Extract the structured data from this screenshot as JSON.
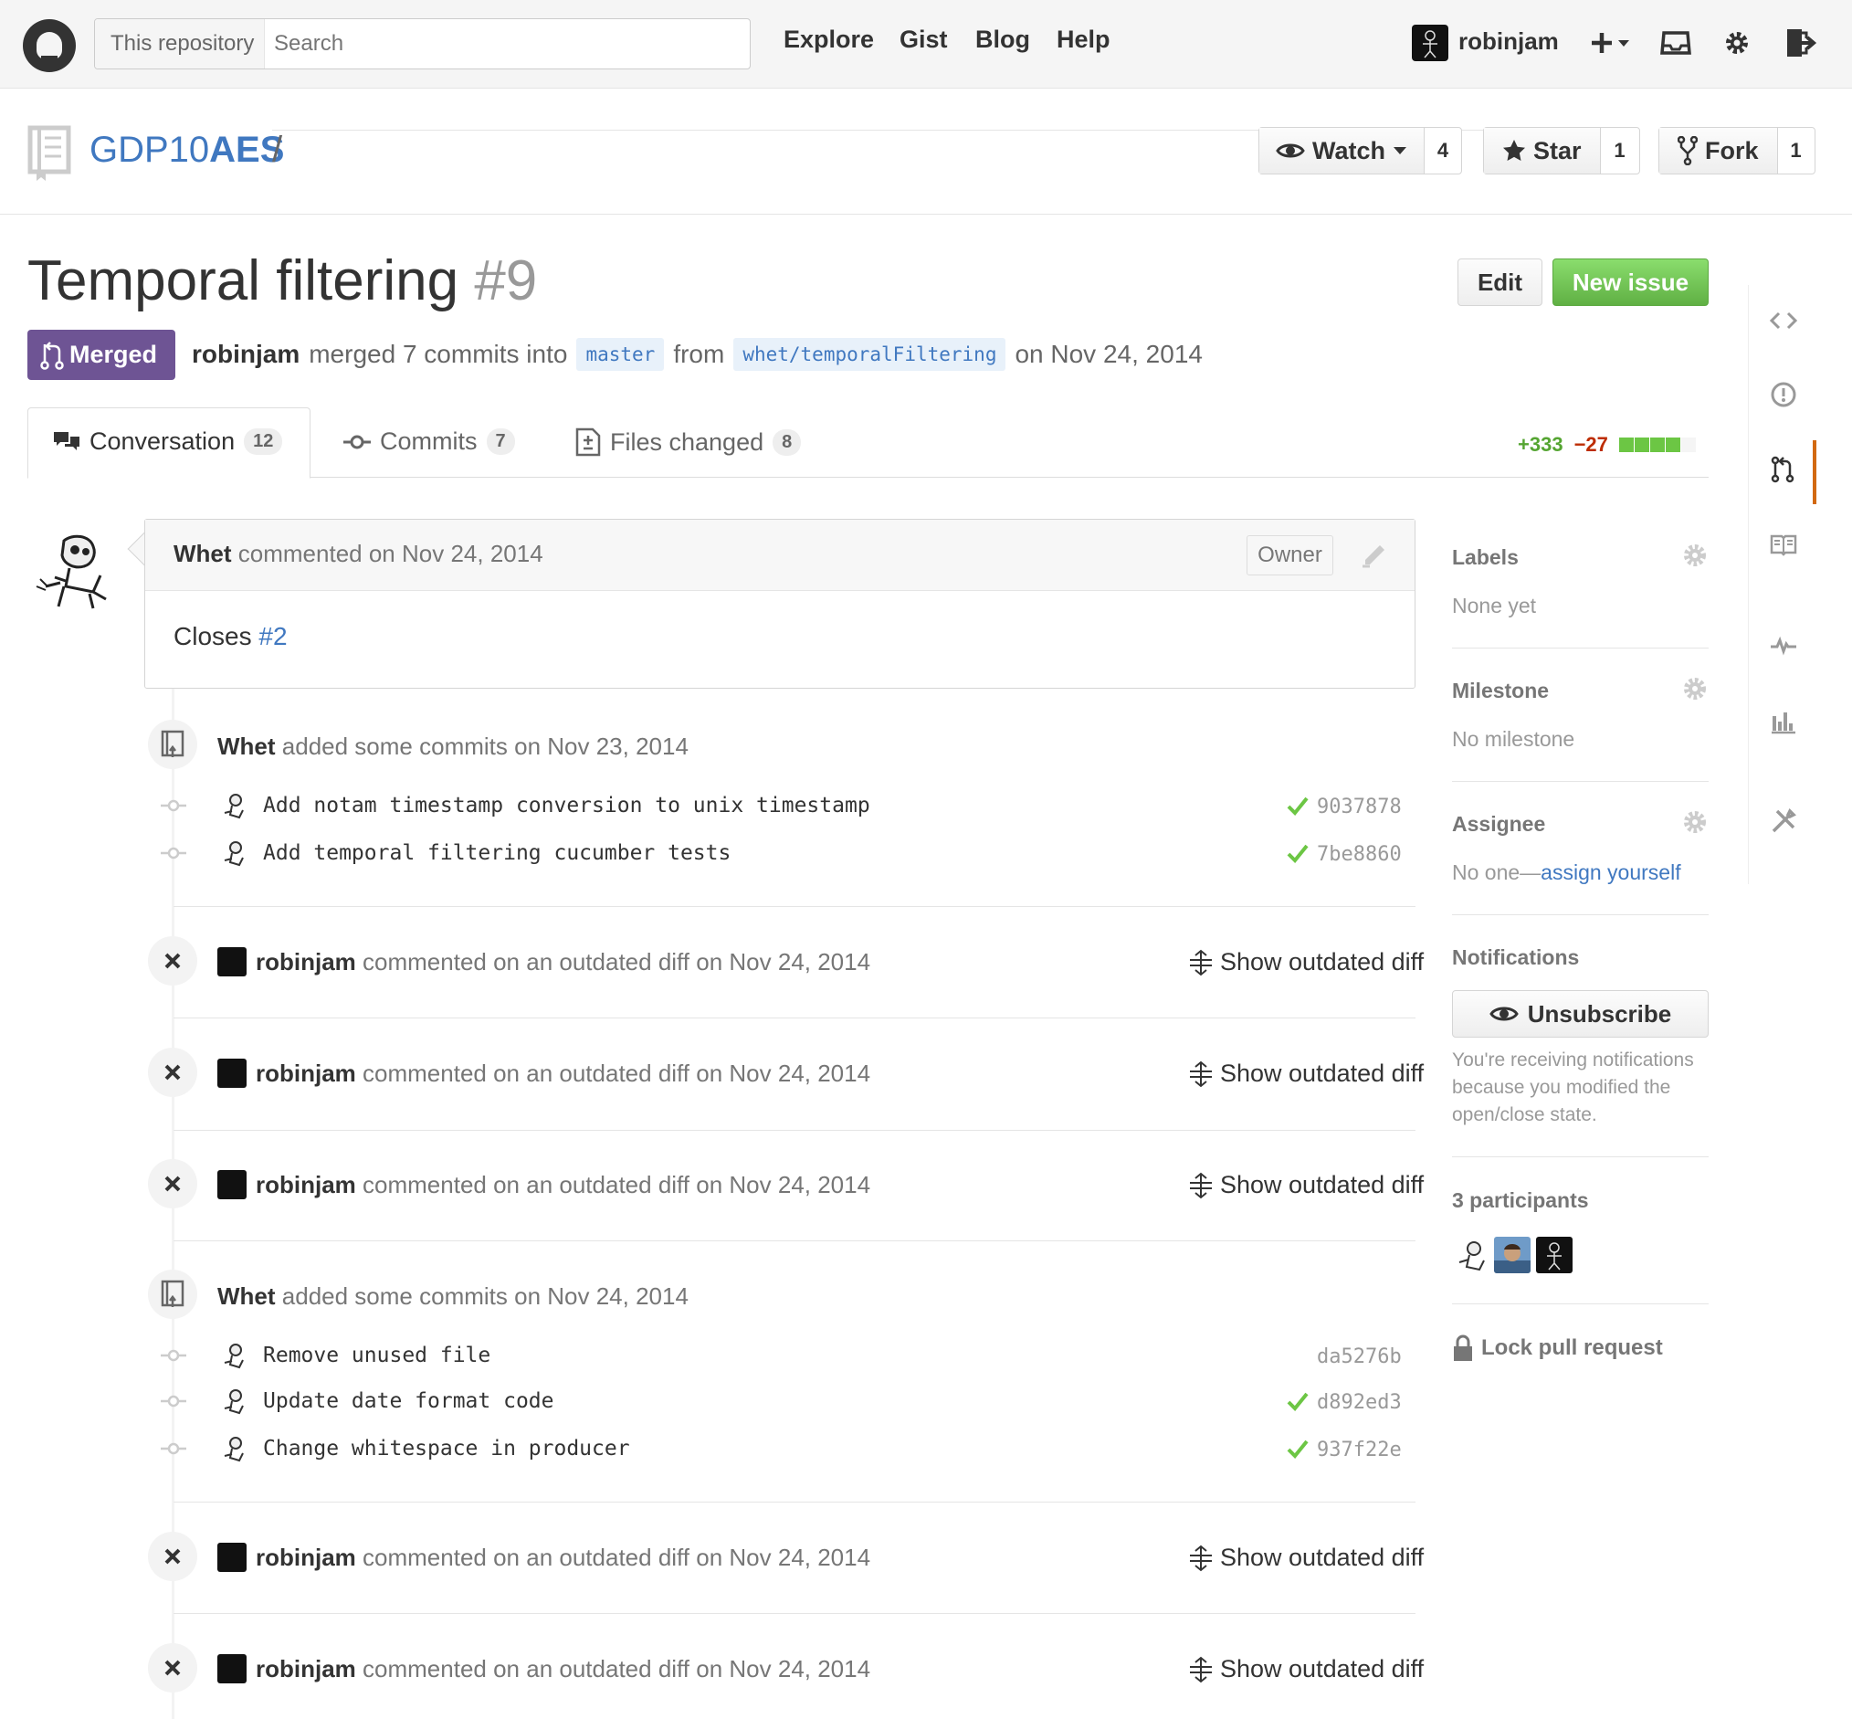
{
  "header": {
    "search_scope": "This repository",
    "search_placeholder": "Search",
    "nav": [
      "Explore",
      "Gist",
      "Blog",
      "Help"
    ],
    "username": "robinjam"
  },
  "repo": {
    "owner": "GDP10",
    "separator": "/",
    "name": "AES",
    "watch_label": "Watch",
    "watch_count": "4",
    "star_label": "Star",
    "star_count": "1",
    "fork_label": "Fork",
    "fork_count": "1"
  },
  "pr": {
    "title": "Temporal filtering",
    "number": "#9",
    "edit_label": "Edit",
    "new_issue_label": "New issue",
    "state": "Merged",
    "merger": "robinjam",
    "merged_text": "merged 7 commits into",
    "base_branch": "master",
    "from_text": "from",
    "head_branch": "whet/temporalFiltering",
    "date_text": "on Nov 24, 2014"
  },
  "tabs": [
    {
      "label": "Conversation",
      "count": "12"
    },
    {
      "label": "Commits",
      "count": "7"
    },
    {
      "label": "Files changed",
      "count": "8"
    }
  ],
  "diffstat": {
    "additions": "+333",
    "deletions": "−27",
    "blocks": [
      "green",
      "green",
      "green",
      "green",
      "grey"
    ]
  },
  "comment": {
    "author": "Whet",
    "action": "commented on Nov 24, 2014",
    "role": "Owner",
    "body_prefix": "Closes",
    "body_link": "#2"
  },
  "timeline": {
    "commit_group_1": {
      "author": "Whet",
      "action": "added some commits on Nov 23, 2014",
      "commits": [
        {
          "message": "Add notam timestamp conversion to unix timestamp",
          "sha": "9037878",
          "status": "success"
        },
        {
          "message": "Add temporal filtering cucumber tests",
          "sha": "7be8860",
          "status": "success"
        }
      ]
    },
    "outdated_1": {
      "author": "robinjam",
      "action": "commented on an outdated diff on Nov 24, 2014",
      "toggle": "Show outdated diff"
    },
    "outdated_2": {
      "author": "robinjam",
      "action": "commented on an outdated diff on Nov 24, 2014",
      "toggle": "Show outdated diff"
    },
    "outdated_3": {
      "author": "robinjam",
      "action": "commented on an outdated diff on Nov 24, 2014",
      "toggle": "Show outdated diff"
    },
    "commit_group_2": {
      "author": "Whet",
      "action": "added some commits on Nov 24, 2014",
      "commits": [
        {
          "message": "Remove unused file",
          "sha": "da5276b",
          "status": "none"
        },
        {
          "message": "Update date format code",
          "sha": "d892ed3",
          "status": "success"
        },
        {
          "message": "Change whitespace in producer",
          "sha": "937f22e",
          "status": "success"
        }
      ]
    },
    "outdated_4": {
      "author": "robinjam",
      "action": "commented on an outdated diff on Nov 24, 2014",
      "toggle": "Show outdated diff"
    },
    "outdated_5": {
      "author": "robinjam",
      "action": "commented on an outdated diff on Nov 24, 2014",
      "toggle": "Show outdated diff"
    }
  },
  "sidebar": {
    "labels_title": "Labels",
    "labels_value": "None yet",
    "milestone_title": "Milestone",
    "milestone_value": "No milestone",
    "assignee_title": "Assignee",
    "assignee_value": "No one—",
    "assignee_link": "assign yourself",
    "notifications_title": "Notifications",
    "unsubscribe_label": "Unsubscribe",
    "notifications_note": "You're receiving notifications because you modified the open/close state.",
    "participants_title": "3 participants",
    "lock_label": "Lock pull request"
  },
  "colors": {
    "merged": "#6e5494",
    "new_issue": "#6cc644",
    "link": "#4078c0",
    "additions": "#55a532",
    "deletions": "#bd2c00",
    "repo_nav_active": "#d26911"
  }
}
